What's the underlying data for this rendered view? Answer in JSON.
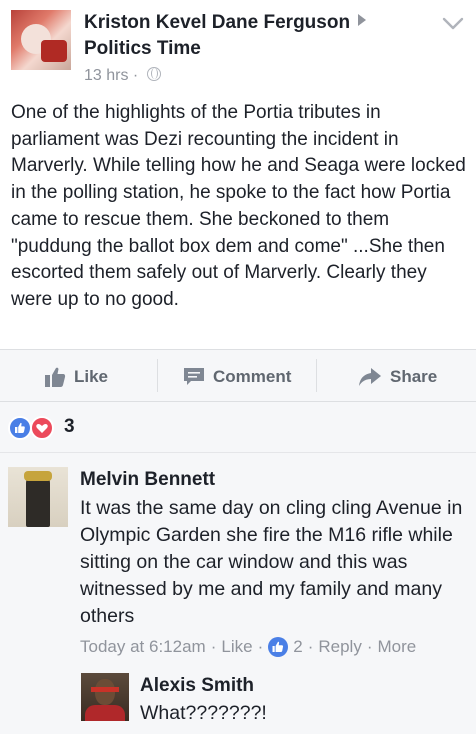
{
  "post": {
    "author": "Kriston Kevel Dane Ferguson",
    "group": "Politics Time",
    "time": "13 hrs",
    "separator": "·",
    "body": "One of the highlights of the Portia tributes in parliament was Dezi recounting the incident in Marverly. While telling how he and Seaga were locked in the polling station, he spoke to the fact how Portia came to rescue them. She beckoned to them \"puddung the ballot box dem and come\" ...She then escorted them safely out of Marverly. Clearly they were up to no good.",
    "icons": {
      "audience": "globe-icon",
      "options": "chevron-down-icon",
      "group_arrow": "caret-right-icon"
    }
  },
  "actions": {
    "like_label": "Like",
    "comment_label": "Comment",
    "share_label": "Share",
    "icons": [
      "thumbs-up-icon",
      "comment-bubble-icon",
      "share-arrow-icon"
    ]
  },
  "reactions": {
    "count": "3",
    "types": [
      "like",
      "love"
    ],
    "colors": {
      "like": "#4a7fe6",
      "love": "#ec4a5b"
    }
  },
  "comments": [
    {
      "name": "Melvin Bennett",
      "text": "It was the same day on cling cling Avenue in Olympic Garden she fire the M16 rifle while sitting on the car window and this was witnessed by me and my family and many others",
      "time": "Today at 6:12am",
      "like_label": "Like",
      "like_count": "2",
      "reply_label": "Reply",
      "more_label": "More",
      "separator": "·"
    },
    {
      "name": "Alexis Smith",
      "text": "What???????!"
    }
  ],
  "colors": {
    "text_primary": "#1d2129",
    "text_secondary": "#90949c",
    "action_text": "#606770",
    "bar_background": "#f6f7f9"
  }
}
